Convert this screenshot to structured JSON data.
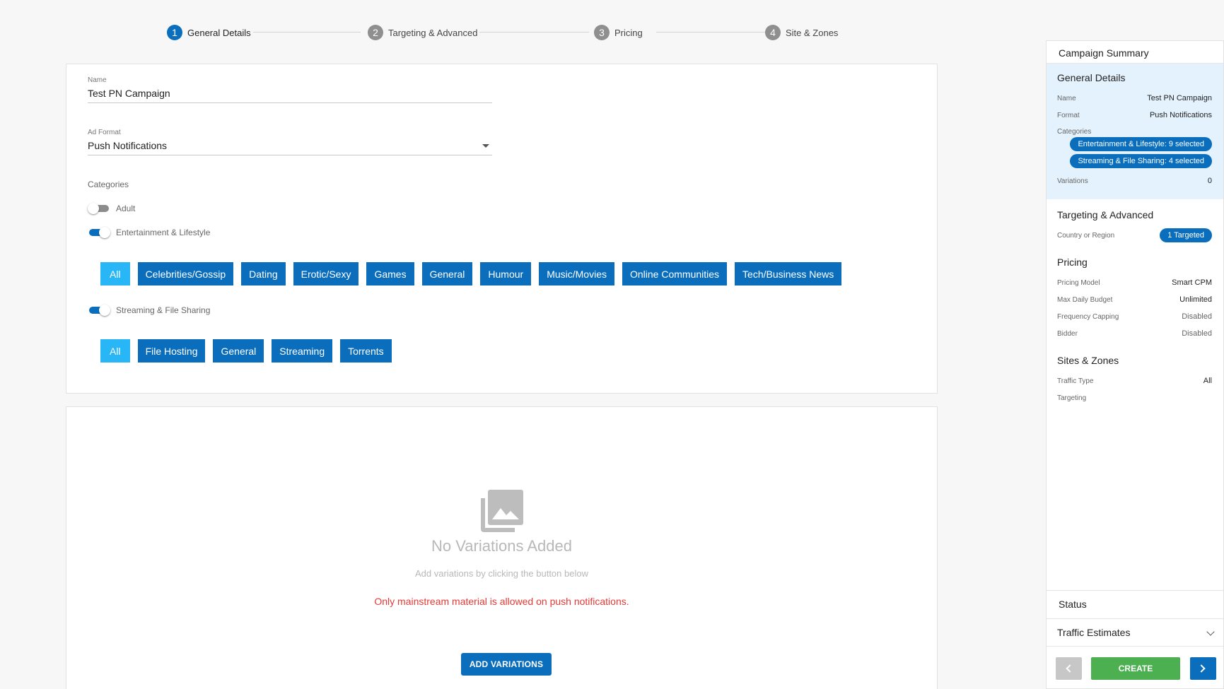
{
  "stepper": [
    {
      "num": "1",
      "label": "General Details",
      "active": true
    },
    {
      "num": "2",
      "label": "Targeting & Advanced",
      "active": false
    },
    {
      "num": "3",
      "label": "Pricing",
      "active": false
    },
    {
      "num": "4",
      "label": "Site & Zones",
      "active": false
    }
  ],
  "form": {
    "name_label": "Name",
    "name_value": "Test PN Campaign",
    "format_label": "Ad Format",
    "format_value": "Push Notifications",
    "categories_label": "Categories",
    "adult_label": "Adult",
    "adult_on": false,
    "ent_label": "Entertainment & Lifestyle",
    "ent_on": true,
    "ent_chips": [
      "All",
      "Celebrities/Gossip",
      "Dating",
      "Erotic/Sexy",
      "Games",
      "General",
      "Humour",
      "Music/Movies",
      "Online Communities",
      "Tech/Business News"
    ],
    "stream_label": "Streaming & File Sharing",
    "stream_on": true,
    "stream_chips": [
      "All",
      "File Hosting",
      "General",
      "Streaming",
      "Torrents"
    ]
  },
  "variations": {
    "icon": "image-gallery-icon",
    "title": "No Variations Added",
    "subtitle": "Add variations by clicking the button below",
    "warning": "Only mainstream material is allowed on push notifications.",
    "button": "ADD VARIATIONS"
  },
  "summary": {
    "title": "Campaign Summary",
    "general": {
      "heading": "General Details",
      "name_k": "Name",
      "name_v": "Test PN Campaign",
      "format_k": "Format",
      "format_v": "Push Notifications",
      "categories_k": "Categories",
      "badge1": "Entertainment & Lifestyle: 9 selected",
      "badge2": "Streaming & File Sharing: 4 selected",
      "variations_k": "Variations",
      "variations_v": "0"
    },
    "targeting": {
      "heading": "Targeting & Advanced",
      "country_k": "Country or Region",
      "country_v": "1 Targeted"
    },
    "pricing": {
      "heading": "Pricing",
      "model_k": "Pricing Model",
      "model_v": "Smart CPM",
      "budget_k": "Max Daily Budget",
      "budget_v": "Unlimited",
      "freq_k": "Frequency Capping",
      "freq_v": "Disabled",
      "bidder_k": "Bidder",
      "bidder_v": "Disabled"
    },
    "sites": {
      "heading": "Sites & Zones",
      "traffic_k": "Traffic Type",
      "traffic_v": "All",
      "targeting_k": "Targeting"
    },
    "status_label": "Status",
    "traffic_estimates_label": "Traffic Estimates",
    "create_label": "CREATE"
  },
  "colors": {
    "primary": "#0a6ebd",
    "chip_all": "#29b6f6",
    "create": "#4caf50",
    "warning": "#e53935",
    "summary_highlight": "#e3f2fd"
  }
}
